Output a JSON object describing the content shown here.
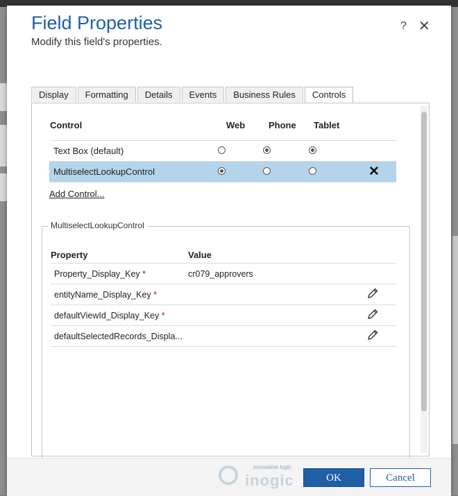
{
  "dialog": {
    "title": "Field Properties",
    "subtitle": "Modify this field's properties.",
    "help_label": "?",
    "close_label": "✕"
  },
  "tabs": [
    {
      "label": "Display"
    },
    {
      "label": "Formatting"
    },
    {
      "label": "Details"
    },
    {
      "label": "Events"
    },
    {
      "label": "Business Rules"
    },
    {
      "label": "Controls",
      "active": true
    }
  ],
  "controls_table": {
    "headers": {
      "control": "Control",
      "web": "Web",
      "phone": "Phone",
      "tablet": "Tablet"
    },
    "rows": [
      {
        "name": "Text Box (default)",
        "web": false,
        "phone": true,
        "tablet": true,
        "selected": false
      },
      {
        "name": "MultiselectLookupControl",
        "web": true,
        "phone": false,
        "tablet": false,
        "selected": true,
        "remove_label": "✕"
      }
    ],
    "add_control_label": "Add Control..."
  },
  "properties": {
    "legend": "MultiselectLookupControl",
    "headers": {
      "property": "Property",
      "value": "Value"
    },
    "required_mark": "*",
    "rows": [
      {
        "name": "Property_Display_Key",
        "required": true,
        "value": "cr079_approvers",
        "editable": false
      },
      {
        "name": "entityName_Display_Key",
        "required": true,
        "value": "",
        "editable": true
      },
      {
        "name": "defaultViewId_Display_Key",
        "required": true,
        "value": "",
        "editable": true
      },
      {
        "name": "defaultSelectedRecords_Displa...",
        "required": false,
        "value": "",
        "editable": true
      }
    ]
  },
  "footer": {
    "logo_tagline": "innovative logic",
    "logo_name": "inogic",
    "ok_label": "OK",
    "cancel_label": "Cancel"
  },
  "colors": {
    "accent": "#1f5fa6",
    "selected_row": "#b3d4ea",
    "required": "#dd0000"
  }
}
